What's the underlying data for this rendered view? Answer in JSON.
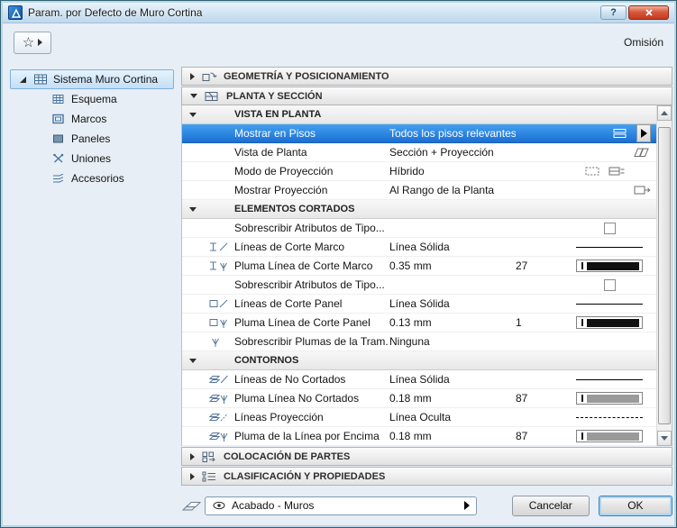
{
  "window": {
    "title": "Param. por Defecto de Muro Cortina",
    "omision": "Omisión"
  },
  "icons": {
    "star": "☆",
    "help": "?"
  },
  "sidebar": {
    "items": [
      {
        "label": "Sistema Muro Cortina",
        "selected": true
      },
      {
        "label": "Esquema"
      },
      {
        "label": "Marcos"
      },
      {
        "label": "Paneles"
      },
      {
        "label": "Uniones"
      },
      {
        "label": "Accesorios"
      }
    ]
  },
  "sections": {
    "geometry": "GEOMETRÍA Y POSICIONAMIENTO",
    "plan": "PLANTA Y SECCIÓN",
    "placement": "COLOCACIÓN DE PARTES",
    "classification": "CLASIFICACIÓN Y PROPIEDADES"
  },
  "plan": {
    "groups": [
      {
        "title": "VISTA EN PLANTA",
        "rows": [
          {
            "label": "Mostrar en Pisos",
            "value": "Todos los pisos relevantes",
            "selected": true
          },
          {
            "label": "Vista de Planta",
            "value": "Sección + Proyección"
          },
          {
            "label": "Modo de Proyección",
            "value": "Híbrido"
          },
          {
            "label": "Mostrar Proyección",
            "value": "Al Rango de la Planta"
          }
        ]
      },
      {
        "title": "ELEMENTOS CORTADOS",
        "rows": [
          {
            "label": "Sobrescribir Atributos de Tipo...",
            "control": "checkbox",
            "checked": false
          },
          {
            "label": "Líneas de Corte Marco",
            "value": "Línea Sólida",
            "preview": "solid-line"
          },
          {
            "label": "Pluma Línea de Corte Marco",
            "value": "0.35 mm",
            "pen": "27",
            "preview": "pen-black"
          },
          {
            "label": "Sobrescribir Atributos de Tipo...",
            "control": "checkbox",
            "checked": false
          },
          {
            "label": "Líneas de Corte Panel",
            "value": "Línea Sólida",
            "preview": "solid-line"
          },
          {
            "label": "Pluma Línea de Corte Panel",
            "value": "0.13 mm",
            "pen": "1",
            "preview": "pen-black"
          },
          {
            "label": "Sobrescribir Plumas de la Tram...",
            "value": "Ninguna"
          }
        ]
      },
      {
        "title": "CONTORNOS",
        "rows": [
          {
            "label": "Líneas de No Cortados",
            "value": "Línea Sólida",
            "preview": "solid-line"
          },
          {
            "label": "Pluma Línea No Cortados",
            "value": "0.18 mm",
            "pen": "87",
            "preview": "pen-gray"
          },
          {
            "label": "Líneas Proyección",
            "value": "Línea Oculta",
            "preview": "dashed-line"
          },
          {
            "label": "Pluma de la Línea por Encima",
            "value": "0.18 mm",
            "pen": "87",
            "preview": "pen-gray"
          }
        ]
      }
    ]
  },
  "footer": {
    "attribute_combo": "Acabado - Muros",
    "cancel": "Cancelar",
    "ok": "OK"
  },
  "colors": {
    "selection_blue": "#1a6fd3",
    "titlebar_blue": "#cfe3f2",
    "dialog_bg": "#e7eef5"
  }
}
